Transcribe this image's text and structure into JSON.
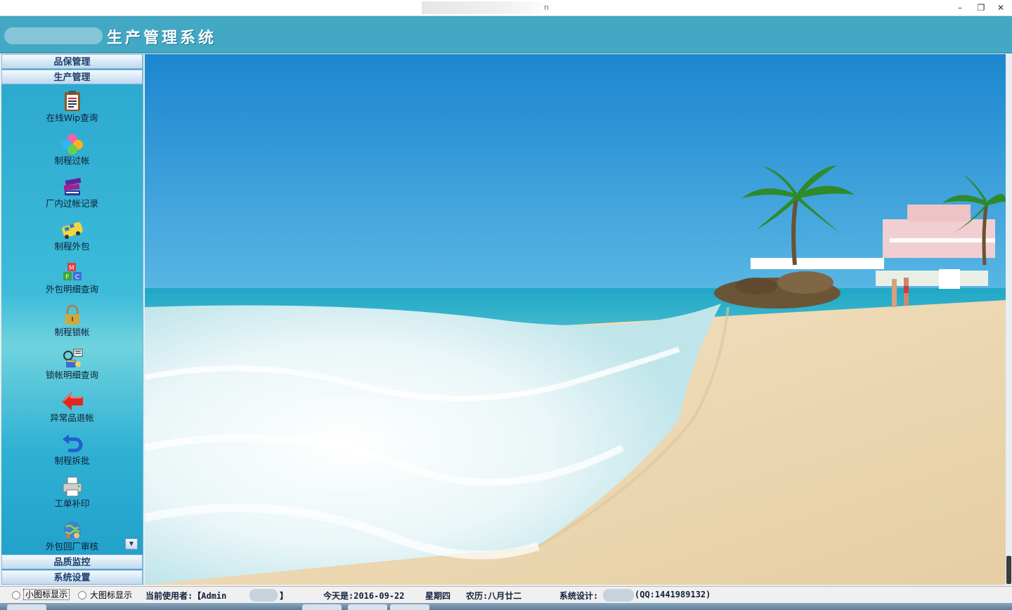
{
  "window": {
    "title_fragment": "n",
    "minimize": "–",
    "restore": "❐",
    "close": "✕"
  },
  "header": {
    "app_title": "生产管理系统"
  },
  "sidebar": {
    "groups_top": [
      {
        "label": "品保管理"
      },
      {
        "label": "生产管理"
      }
    ],
    "items": [
      {
        "label": "在线Wip查询",
        "icon": "clipboard-report-icon"
      },
      {
        "label": "制程过帐",
        "icon": "color-petals-icon"
      },
      {
        "label": "厂内过帐记录",
        "icon": "books-stack-icon"
      },
      {
        "label": "制程外包",
        "icon": "bus-icon"
      },
      {
        "label": "外包明细查询",
        "icon": "letter-blocks-icon"
      },
      {
        "label": "制程锁帐",
        "icon": "padlock-icon"
      },
      {
        "label": "锁帐明细查询",
        "icon": "lock-key-search-icon"
      },
      {
        "label": "异常品退帐",
        "icon": "red-left-arrow-icon"
      },
      {
        "label": "制程拆批",
        "icon": "undo-arrow-icon"
      },
      {
        "label": "工单补印",
        "icon": "printer-icon"
      },
      {
        "label": "外包回厂审核",
        "icon": "globe-people-icon"
      }
    ],
    "groups_bottom": [
      {
        "label": "品质监控"
      },
      {
        "label": "系统设置"
      }
    ],
    "scroll_down": "▼"
  },
  "statusbar": {
    "small_icon_label": "小图标显示",
    "large_icon_label": "大图标显示",
    "user_prefix": "当前使用者:【Admin",
    "user_suffix": "】",
    "today": "今天是:2016-09-22",
    "weekday": "星期四",
    "lunar": "农历:八月廿二",
    "designer_prefix": "系统设计:",
    "designer_suffix": "(QQ:1441989132)"
  },
  "colors": {
    "header_bg": "#43a8c4",
    "sidebar_bg": "#2aa7cd",
    "group_header_text": "#1d3f6a"
  }
}
